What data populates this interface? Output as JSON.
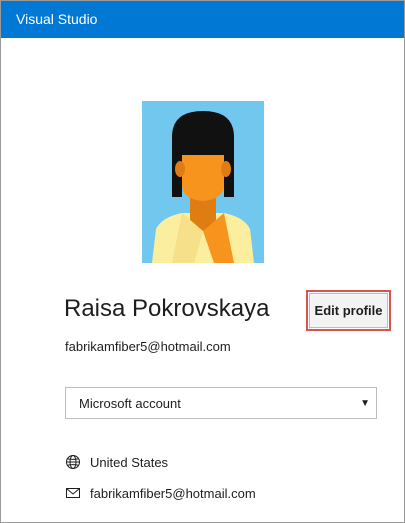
{
  "window": {
    "title": "Visual Studio"
  },
  "profile": {
    "name": "Raisa Pokrovskaya",
    "email": "fabrikamfiber5@hotmail.com",
    "edit_label": "Edit profile",
    "avatar_colors": {
      "background": "#72c7ee",
      "hair": "#111111",
      "skin": "#f7941d",
      "shirt": "#fbef9f"
    }
  },
  "account": {
    "selected": "Microsoft account",
    "chevron": "▼"
  },
  "details": [
    {
      "icon": "globe-icon",
      "text": "United States"
    },
    {
      "icon": "mail-icon",
      "text": "fabrikamfiber5@hotmail.com"
    }
  ],
  "colors": {
    "titlebar": "#0078d4",
    "highlight": "#d9534f"
  }
}
